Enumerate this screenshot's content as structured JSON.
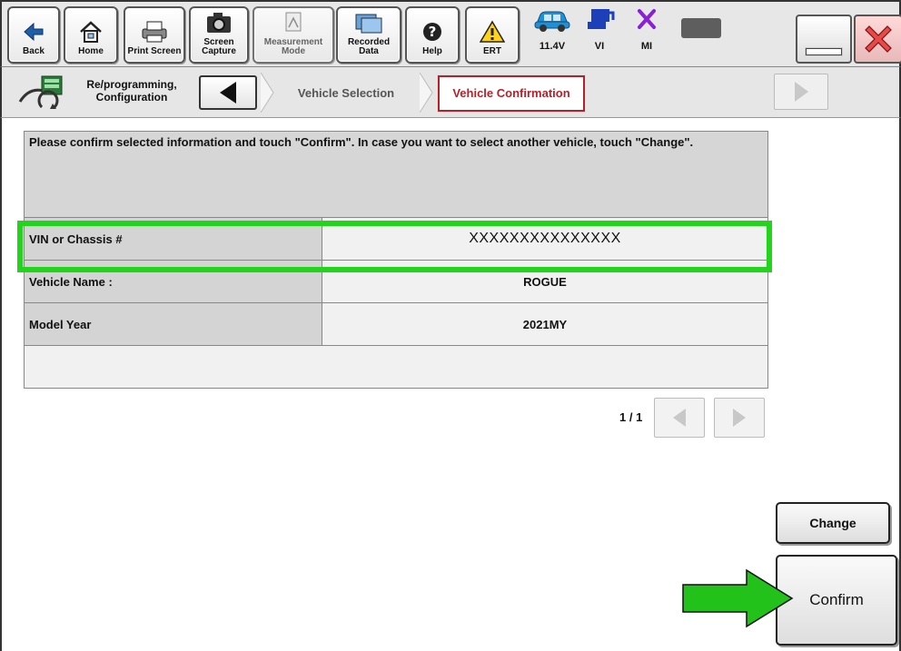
{
  "toolbar": {
    "buttons": [
      {
        "label": "Back",
        "icon": "back-arrow-icon"
      },
      {
        "label": "Home",
        "icon": "home-icon"
      },
      {
        "label": "Print Screen",
        "icon": "printer-icon"
      },
      {
        "label": "Screen\nCapture",
        "icon": "camera-icon"
      },
      {
        "label": "Measurement\nMode",
        "icon": "measurement-icon"
      },
      {
        "label": "Recorded\nData",
        "icon": "recorded-data-icon"
      },
      {
        "label": "Help",
        "icon": "help-icon"
      },
      {
        "label": "ERT",
        "icon": "warning-icon"
      }
    ],
    "status": {
      "battery_voltage": "11.4V",
      "vi_label": "VI",
      "mi_label": "MI"
    }
  },
  "nav": {
    "mode_label": "Re/programming,\nConfiguration",
    "crumbs": [
      "Vehicle Selection",
      "Vehicle Confirmation"
    ]
  },
  "message": "Please confirm selected information and touch \"Confirm\". In case you want to select another vehicle, touch \"Change\".",
  "rows": [
    {
      "label": "VIN or Chassis #",
      "value": "XXXXXXXXXXXXXXX"
    },
    {
      "label": "Vehicle Name :",
      "value": "ROGUE"
    },
    {
      "label": "Model Year",
      "value": "2021MY"
    }
  ],
  "pager": "1 / 1",
  "buttons": {
    "change": "Change",
    "confirm": "Confirm"
  },
  "colors": {
    "highlight": "#22d51c",
    "active_crumb": "#b5212a",
    "pointer_arrow": "#22c21a"
  }
}
